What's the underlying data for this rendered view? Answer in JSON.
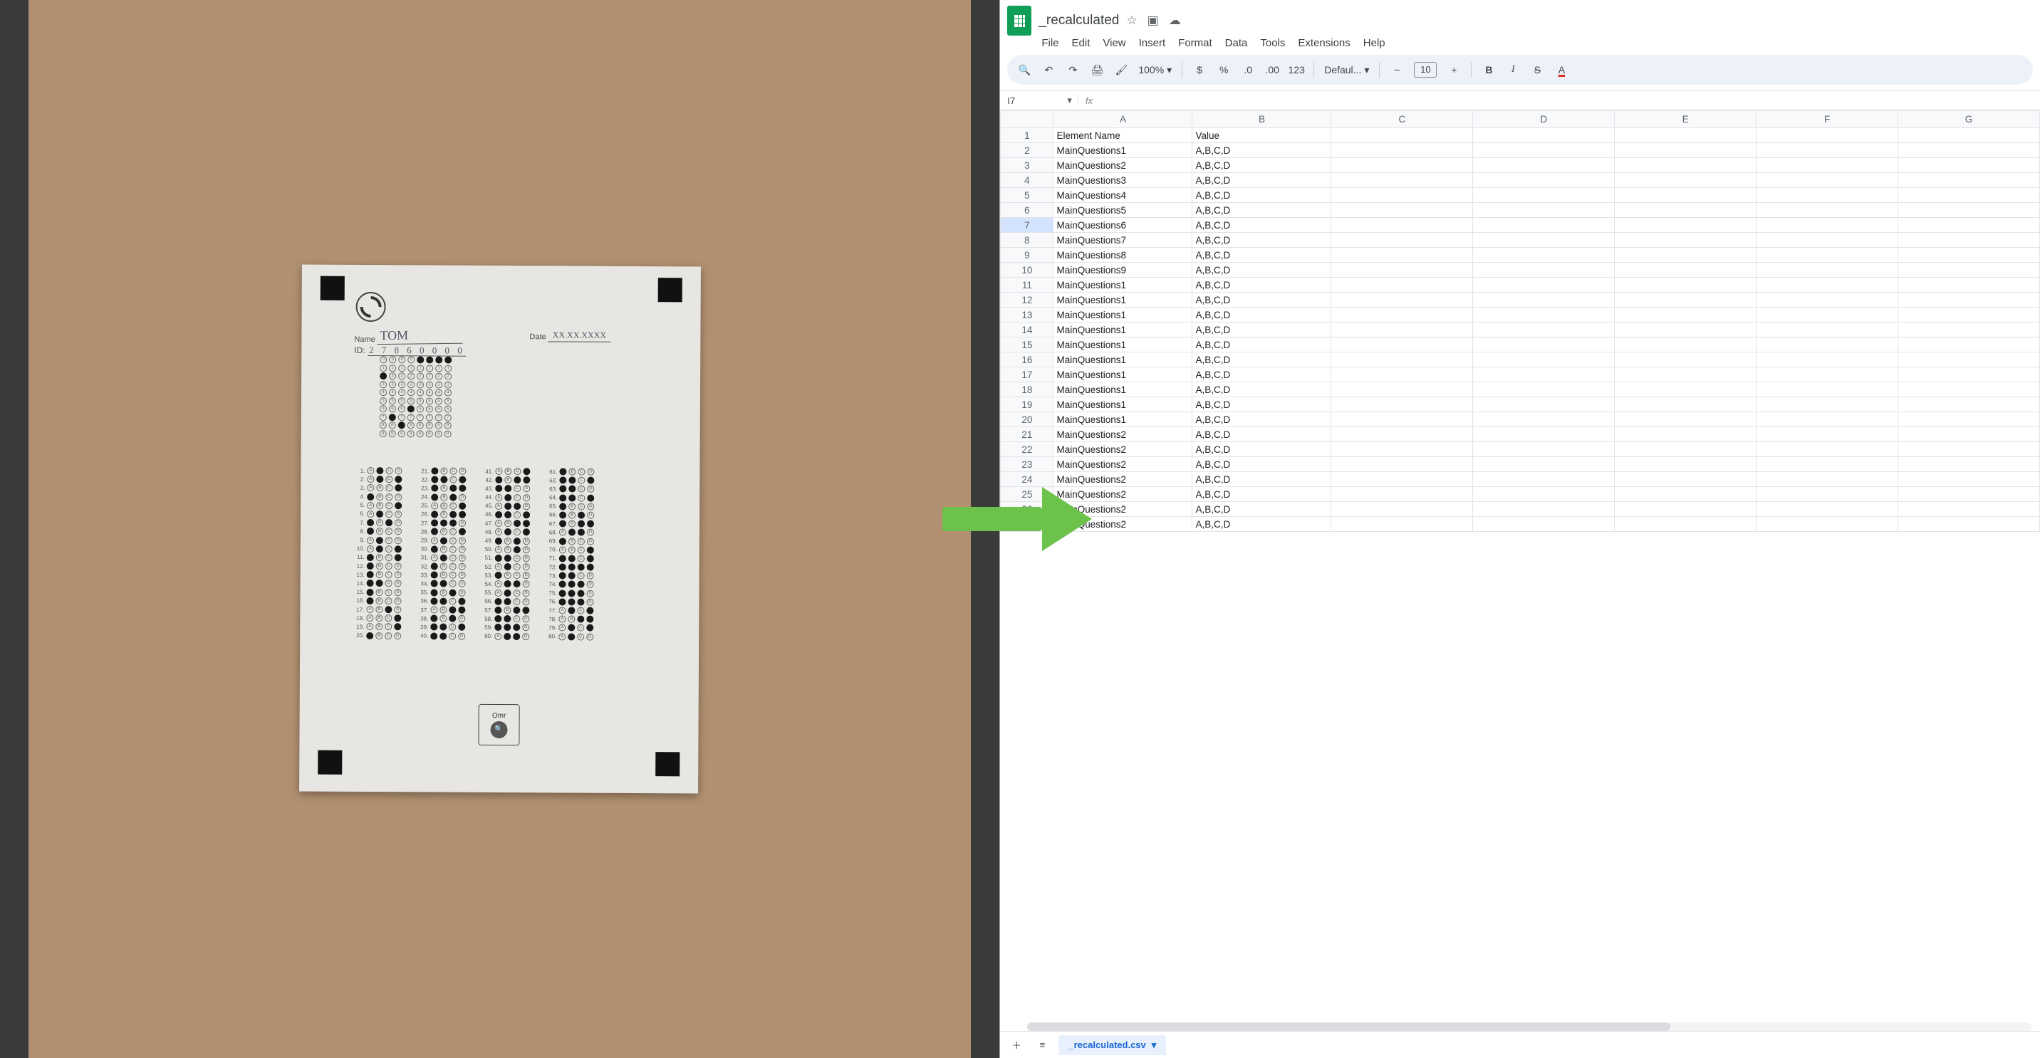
{
  "domain": "Computer-Use",
  "omr": {
    "name_label": "Name",
    "name_value": "TOM",
    "date_label": "Date",
    "date_value": "XX.XX.XXXX",
    "id_label": "ID:",
    "id_value": "2 7 8 6 0 0 0 0",
    "id_fill": [
      2,
      7,
      8,
      6,
      0,
      0,
      0,
      0
    ],
    "box_label": "Omr",
    "answers": [
      [
        1
      ],
      [
        1,
        3
      ],
      [
        3
      ],
      [
        0
      ],
      [
        3
      ],
      [
        1
      ],
      [
        0,
        2
      ],
      [
        0
      ],
      [
        1
      ],
      [
        1,
        3
      ],
      [
        0,
        3
      ],
      [
        0
      ],
      [
        0
      ],
      [
        0,
        1
      ],
      [
        0
      ],
      [
        0
      ],
      [
        2
      ],
      [
        3
      ],
      [
        3
      ],
      [
        0
      ],
      [
        0
      ],
      [
        0,
        1,
        3
      ],
      [
        0,
        2,
        3
      ],
      [
        0,
        2
      ],
      [
        3
      ],
      [
        0,
        2,
        3
      ],
      [
        0,
        1,
        2
      ],
      [
        0,
        3
      ],
      [
        1
      ],
      [
        0
      ],
      [
        1
      ],
      [
        0
      ],
      [
        0
      ],
      [
        0,
        1
      ],
      [
        0,
        2
      ],
      [
        0,
        1,
        3
      ],
      [
        2,
        3
      ],
      [
        0,
        2
      ],
      [
        0,
        1,
        3
      ],
      [
        0,
        1
      ],
      [
        3
      ],
      [
        0,
        2,
        3
      ],
      [
        0,
        1
      ],
      [
        1
      ],
      [
        1,
        2
      ],
      [
        0,
        1,
        3
      ],
      [
        2,
        3
      ],
      [
        1,
        3
      ],
      [
        0,
        2
      ],
      [
        2
      ],
      [
        0,
        1
      ],
      [
        1
      ],
      [
        0
      ],
      [
        1,
        2
      ],
      [
        1
      ],
      [
        0,
        1
      ],
      [
        0,
        2,
        3
      ],
      [
        0,
        1
      ],
      [
        0,
        1,
        2
      ],
      [
        1,
        2
      ],
      [
        0
      ],
      [
        0,
        1,
        3
      ],
      [
        0,
        1
      ],
      [
        0,
        1,
        3
      ],
      [
        0
      ],
      [
        0,
        2
      ],
      [
        0,
        2,
        3
      ],
      [
        1,
        2
      ],
      [
        0
      ],
      [
        3
      ],
      [
        0,
        1,
        3
      ],
      [
        0,
        1,
        2,
        3
      ],
      [
        0,
        1
      ],
      [
        0,
        1,
        2
      ],
      [
        0,
        1,
        2
      ],
      [
        0,
        1,
        2
      ],
      [
        1,
        3
      ],
      [
        2,
        3
      ],
      [
        1,
        3
      ],
      [
        1
      ]
    ]
  },
  "sheets": {
    "doc_title": "_recalculated",
    "icons": {
      "star": "☆",
      "move": "▣",
      "cloud": "☁"
    },
    "menu": [
      "File",
      "Edit",
      "View",
      "Insert",
      "Format",
      "Data",
      "Tools",
      "Extensions",
      "Help"
    ],
    "toolbar": {
      "search": "🔍",
      "undo": "↶",
      "redo": "↷",
      "print": "🖨",
      "paint": "🖌",
      "zoom": "100%",
      "currency": "$",
      "percent": "%",
      "dec_dec": ".0",
      "dec_inc": ".00",
      "numfmt": "123",
      "font": "Defaul...",
      "minus": "−",
      "fontsize": "10",
      "plus": "+",
      "bold": "B",
      "italic": "I",
      "strike": "S",
      "textcolor": "A"
    },
    "cell_ref": "I7",
    "fx": "fx",
    "columns": [
      "A",
      "B",
      "C",
      "D",
      "E",
      "F",
      "G"
    ],
    "header": [
      "Element Name",
      "Value"
    ],
    "rows": [
      [
        "MainQuestions1",
        "A,B,C,D"
      ],
      [
        "MainQuestions2",
        "A,B,C,D"
      ],
      [
        "MainQuestions3",
        "A,B,C,D"
      ],
      [
        "MainQuestions4",
        "A,B,C,D"
      ],
      [
        "MainQuestions5",
        "A,B,C,D"
      ],
      [
        "MainQuestions6",
        "A,B,C,D"
      ],
      [
        "MainQuestions7",
        "A,B,C,D"
      ],
      [
        "MainQuestions8",
        "A,B,C,D"
      ],
      [
        "MainQuestions9",
        "A,B,C,D"
      ],
      [
        "MainQuestions1",
        "A,B,C,D"
      ],
      [
        "MainQuestions1",
        "A,B,C,D"
      ],
      [
        "MainQuestions1",
        "A,B,C,D"
      ],
      [
        "MainQuestions1",
        "A,B,C,D"
      ],
      [
        "MainQuestions1",
        "A,B,C,D"
      ],
      [
        "MainQuestions1",
        "A,B,C,D"
      ],
      [
        "MainQuestions1",
        "A,B,C,D"
      ],
      [
        "MainQuestions1",
        "A,B,C,D"
      ],
      [
        "MainQuestions1",
        "A,B,C,D"
      ],
      [
        "MainQuestions1",
        "A,B,C,D"
      ],
      [
        "MainQuestions2",
        "A,B,C,D"
      ],
      [
        "MainQuestions2",
        "A,B,C,D"
      ],
      [
        "MainQuestions2",
        "A,B,C,D"
      ],
      [
        "MainQuestions2",
        "A,B,C,D"
      ],
      [
        "MainQuestions2",
        "A,B,C,D"
      ],
      [
        "MainQuestions2",
        "A,B,C,D"
      ],
      [
        "MainQuestions2",
        "A,B,C,D"
      ]
    ],
    "selected_row": 7,
    "tab_label": "_recalculated.csv",
    "add": "＋",
    "all": "≡"
  }
}
